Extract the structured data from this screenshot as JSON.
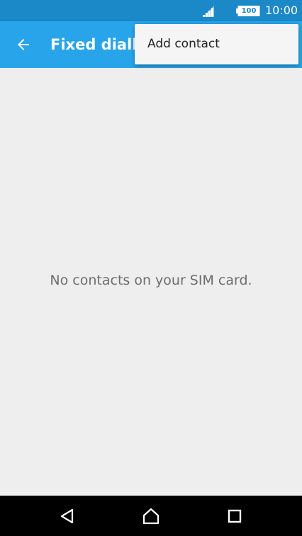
{
  "status_bar": {
    "time": "10:00",
    "battery_level": "100",
    "icons": [
      "signal-icon",
      "battery-icon"
    ]
  },
  "app_bar": {
    "title": "Fixed dialling numbers",
    "back_icon": "arrow-left-icon"
  },
  "overflow_menu": {
    "items": [
      {
        "label": "Add contact"
      }
    ]
  },
  "content": {
    "empty_message": "No contacts on your SIM card."
  },
  "navigation_bar": {
    "buttons": [
      "back-triangle-icon",
      "home-icon",
      "recents-square-icon"
    ]
  },
  "colors": {
    "status_bar": "#1b88c8",
    "app_bar": "#28a5ea",
    "background": "#eeeeee",
    "menu_background": "#f5f5f5",
    "nav_bar": "#000000"
  }
}
